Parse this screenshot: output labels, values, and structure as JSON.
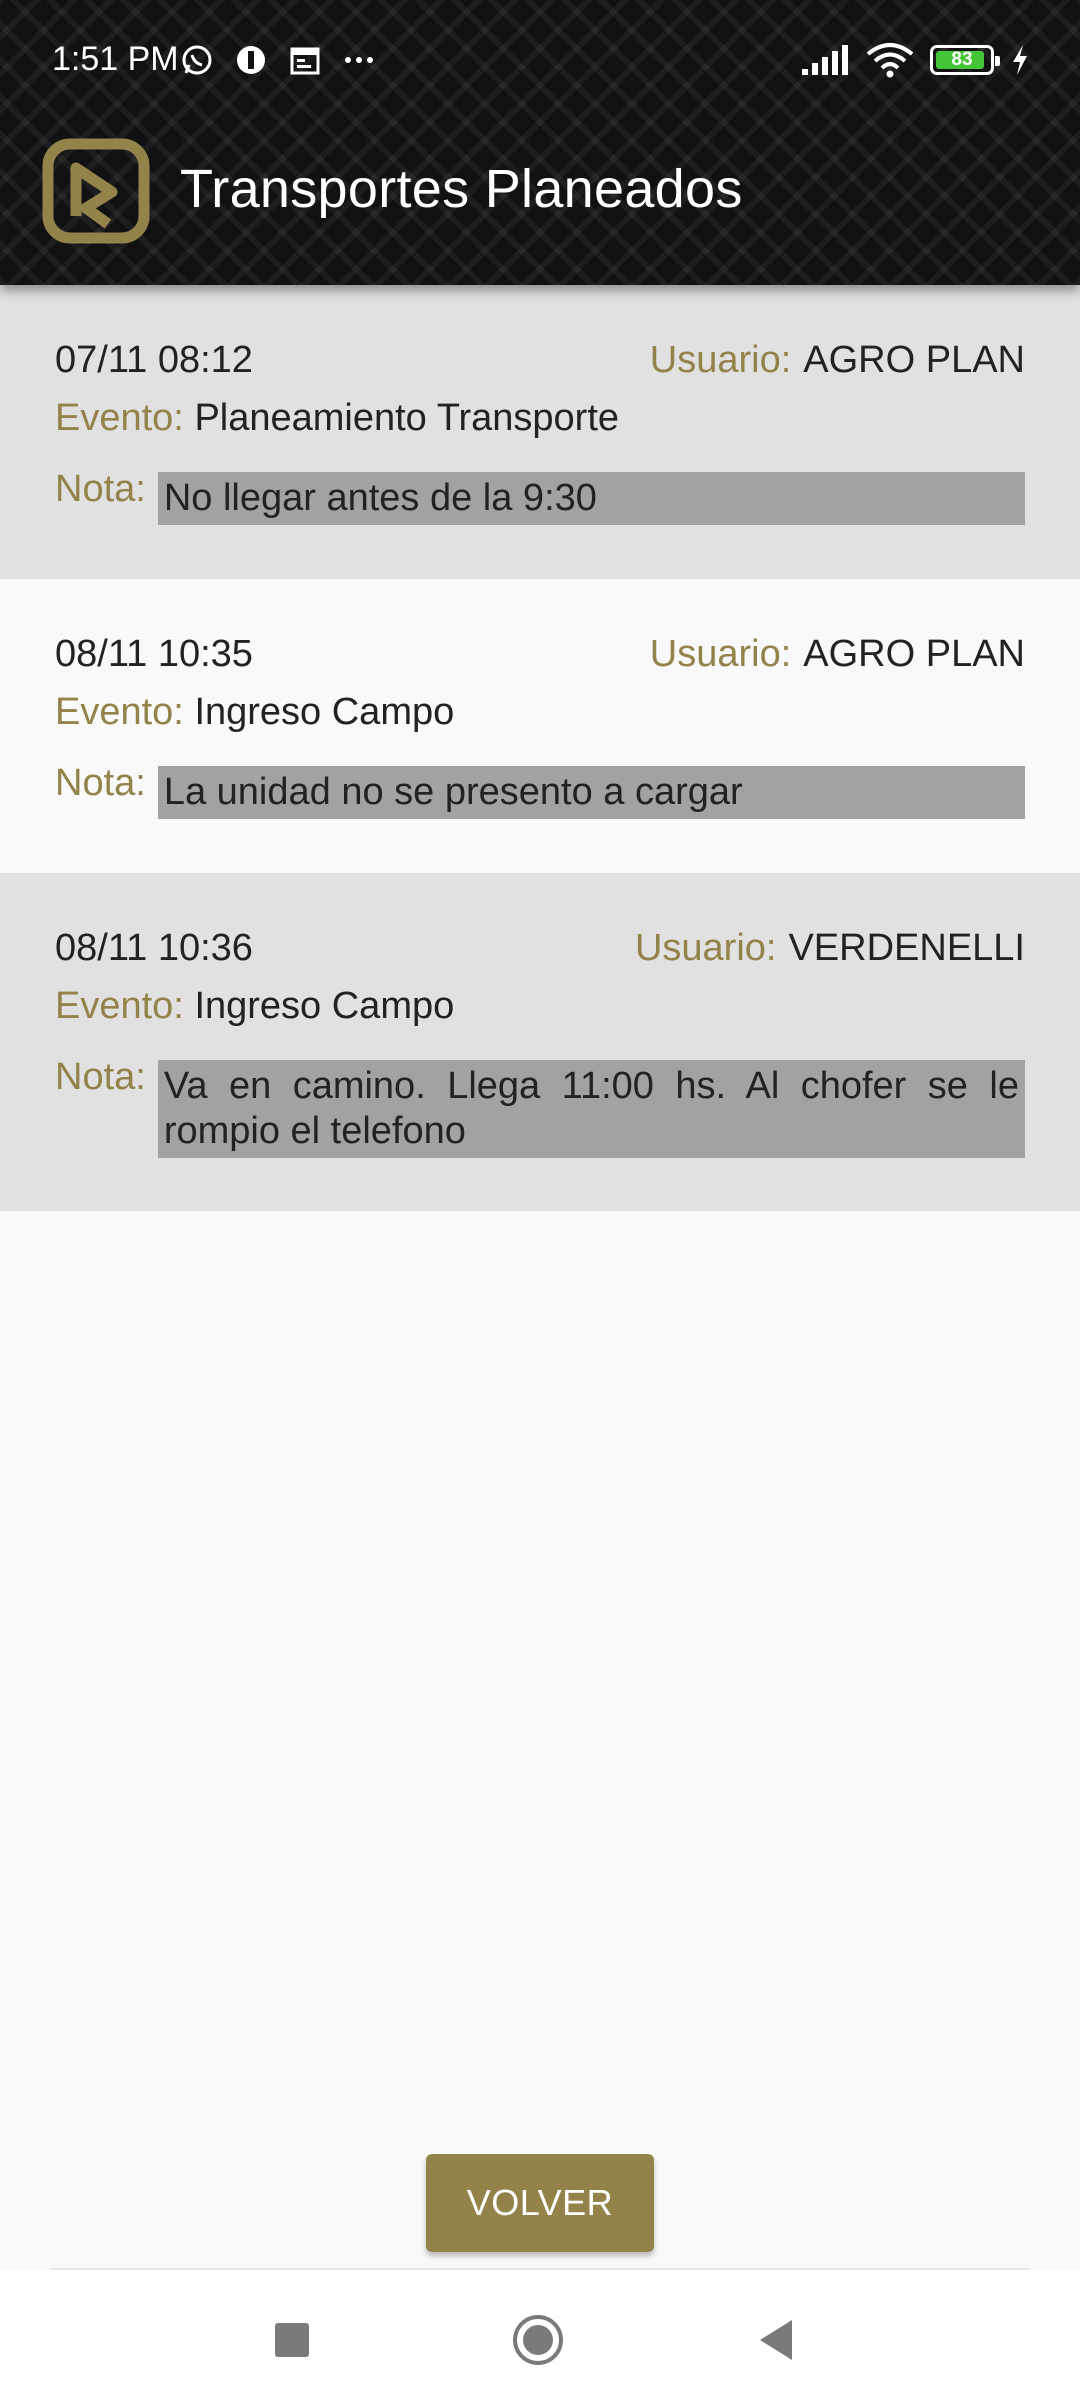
{
  "status_bar": {
    "time": "1:51 PM",
    "battery_level": "83",
    "icons_left": [
      "whatsapp-icon",
      "app-notification-icon",
      "calendar-icon",
      "more-dots-icon"
    ],
    "icons_right": [
      "signal-icon",
      "wifi-icon",
      "battery-icon",
      "charging-bolt-icon"
    ]
  },
  "header": {
    "title": "Transportes Planeados",
    "logo": "brand-logo",
    "accent_color": "#93834a"
  },
  "labels": {
    "usuario": "Usuario:",
    "evento": "Evento:",
    "nota": "Nota:"
  },
  "entries": [
    {
      "datetime": "07/11 08:12",
      "usuario": "AGRO PLAN",
      "evento": "Planeamiento Transporte",
      "nota": "No llegar antes de la 9:30"
    },
    {
      "datetime": "08/11 10:35",
      "usuario": "AGRO PLAN",
      "evento": "Ingreso Campo",
      "nota": "La unidad no se presento a cargar"
    },
    {
      "datetime": "08/11 10:36",
      "usuario": "VERDENELLI",
      "evento": "Ingreso Campo",
      "nota": "Va en camino. Llega 11:00 hs. Al chofer se le rompio el telefono"
    }
  ],
  "actions": {
    "volver_label": "VOLVER"
  },
  "navbar": {
    "items": [
      "recents-square-icon",
      "home-circle-icon",
      "back-triangle-icon"
    ]
  }
}
